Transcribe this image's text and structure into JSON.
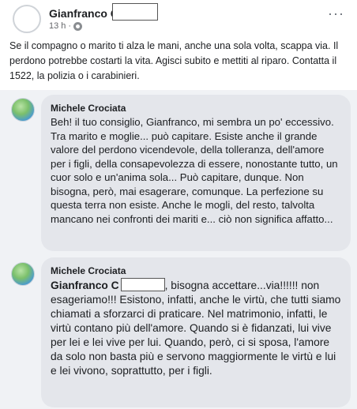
{
  "post": {
    "author": "Gianfranco C",
    "time": "13 h",
    "separator": "·",
    "more": "···",
    "text": "Se il compagno o marito ti alza le mani, anche una sola volta, scappa via. Il perdono potrebbe costarti la vita. Agisci subito e mettiti al riparo. Contatta il 1522, la polizia o i carabinieri."
  },
  "comments": [
    {
      "author": "Michele Crociata",
      "text": "Beh! il tuo consiglio, Gianfranco, mi sembra un po' eccessivo. Tra marito e moglie... può capitare. Esiste anche il grande valore del perdono vicendevole, della tolleranza, dell'amore per i figli, della consapevolezza di essere, nonostante tutto, un cuor solo e un'anima sola... Può capitare, dunque. Non bisogna, però, mai esagerare, comunque. La perfezione su questa terra non esiste. Anche le mogli, del resto, talvolta mancano nei confronti dei mariti e... ciò non significa affatto..."
    },
    {
      "author": "Michele Crociata",
      "mention": "Gianfranco C",
      "text": ", bisogna accettare...via!!!!!! non esageriamo!!! Esistono, infatti, anche le virtù, che tutti siamo chiamati a sforzarci di praticare. Nel matrimonio, infatti, le virtù contano più dell'amore. Quando si è fidanzati, lui vive per lei e lei vive per lui. Quando, però, ci si sposa, l'amore da solo non basta più e servono maggiormente le virtù e lui e lei vivono, soprattutto, per i figli."
    }
  ],
  "icons": {
    "post_avatar": "avatar-icon",
    "privacy": "globe-icon",
    "more": "more-options-icon",
    "comment_avatar": "profile-avatar-icon"
  },
  "colors": {
    "background": "#f0f2f5",
    "card": "#ffffff",
    "bubble": "#e4e6eb",
    "text": "#1c1e21",
    "meta": "#65676b"
  }
}
